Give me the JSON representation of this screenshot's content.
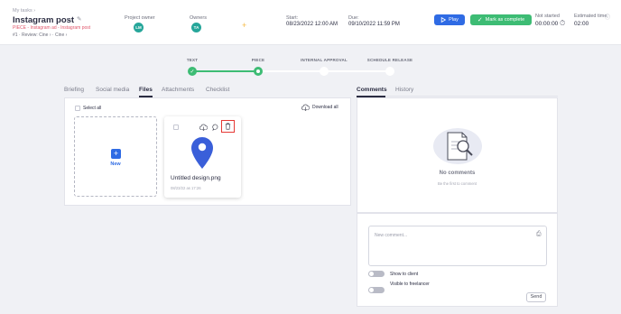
{
  "header": {
    "breadcrumb": "My tasks",
    "title": "Instagram post",
    "piece_line": "PIECE - Instagram ad - Instagram post",
    "meta_line": "#1 · Review: Cine ›  · Cine ›",
    "project_owner_label": "Project owner",
    "project_owner_initials": "LM",
    "owners_label": "Owners",
    "owners_initials": "TA",
    "start_label": "Start:",
    "start_value": "08/23/2022 12:00 AM",
    "due_label": "Due:",
    "due_value": "09/10/2022 11:59 PM",
    "play_label": "Play",
    "complete_label": "Mark as complete",
    "status_label": "Not started",
    "timer_value": "00:00:00",
    "estimated_label": "Estimated time",
    "estimated_value": "02:00"
  },
  "progress": {
    "steps": [
      {
        "label": "TEXT",
        "state": "done"
      },
      {
        "label": "PIECE",
        "state": "current"
      },
      {
        "label": "INTERNAL APPROVAL",
        "state": "todo"
      },
      {
        "label": "SCHEDULE RELEASE",
        "state": "todo"
      }
    ]
  },
  "tabs": {
    "items": [
      "Briefing",
      "Social media",
      "Files",
      "Attachments",
      "Checklist"
    ],
    "active": "Files"
  },
  "files": {
    "select_all_label": "Select all",
    "download_all_label": "Download all",
    "new_label": "New",
    "file_name": "Untitled design.png",
    "file_date": "08/23/22 as 17:26"
  },
  "comments": {
    "tabs": [
      "Comments",
      "History"
    ],
    "active_tab": "Comments",
    "empty_title": "No comments",
    "empty_subtitle": "Be the first to comment",
    "input_placeholder": "New comment...",
    "show_client_label": "Show to client",
    "visible_freelancer_label": "Visible to freelancer",
    "send_label": "Send"
  },
  "colors": {
    "accent_blue": "#2f6be4",
    "accent_green": "#3dbc74",
    "pin_blue": "#3a5fd9",
    "highlight_red": "#e53935",
    "piece_red": "#e0566b"
  }
}
